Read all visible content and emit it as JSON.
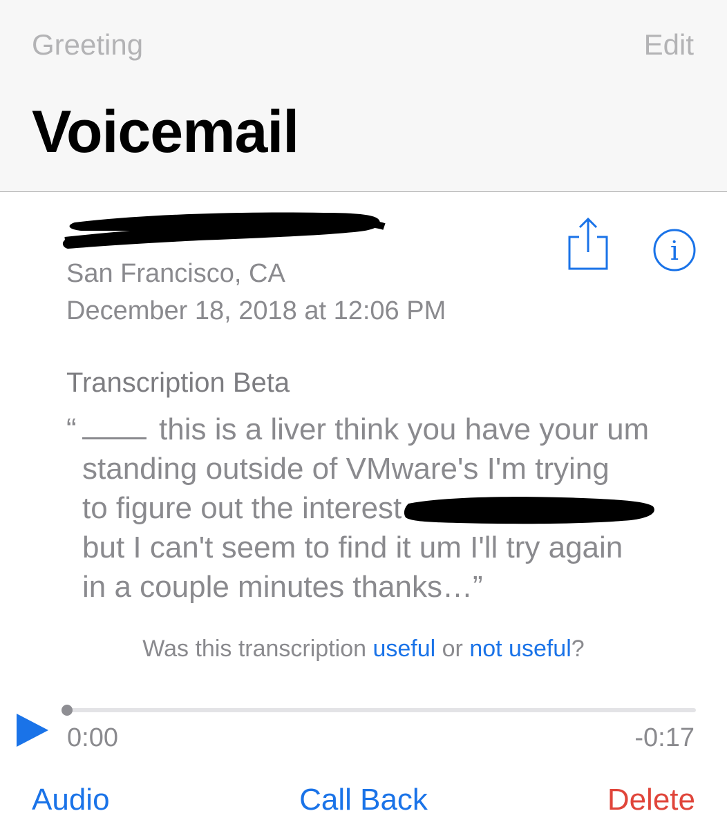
{
  "nav": {
    "greeting_label": "Greeting",
    "edit_label": "Edit",
    "title": "Voicemail"
  },
  "voicemail": {
    "caller_redacted": true,
    "location": "San Francisco, CA",
    "datetime": "December 18, 2018 at 12:06 PM",
    "share_icon": "share-icon",
    "info_icon": "info-icon"
  },
  "transcription": {
    "label": "Transcription Beta",
    "open_quote": "“",
    "lines": [
      "this is a liver think you have your um",
      "standing outside of VMware's I'm trying",
      "to figure out the interest",
      "but I can't seem to find it um I'll try again",
      "in a couple minutes thanks…”"
    ],
    "feedback": {
      "prefix": "Was this transcription ",
      "useful": "useful",
      "middle": " or ",
      "not_useful": "not useful",
      "suffix": "?"
    }
  },
  "player": {
    "elapsed": "0:00",
    "remaining": "-0:17",
    "progress": 0,
    "play_icon": "play-icon",
    "accent": "#1a73e8"
  },
  "actions": {
    "audio": "Audio",
    "call_back": "Call Back",
    "delete": "Delete",
    "delete_color": "#e0453a"
  }
}
